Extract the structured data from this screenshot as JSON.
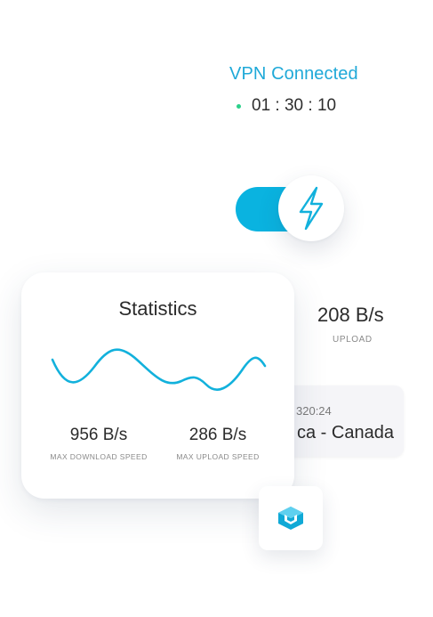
{
  "status": {
    "title": "VPN Connected",
    "timer": "01 : 30 : 10",
    "connected_color": "#2bd08a"
  },
  "toggle": {
    "state": "on",
    "icon": "lightning-bolt-icon",
    "accent": "#0ab3e0"
  },
  "upload": {
    "value": "208 B/s",
    "label": "UPLOAD"
  },
  "server": {
    "ip_partial": "320:24",
    "name_partial": "ca - Canada"
  },
  "statistics": {
    "title": "Statistics",
    "download_value": "956 B/s",
    "download_label": "MAX DOWNLOAD SPEED",
    "upload_value": "286 B/s",
    "upload_label": "MAX UPLOAD SPEED",
    "line_color": "#12b1dc"
  },
  "logo": {
    "icon": "app-logo-icon"
  }
}
